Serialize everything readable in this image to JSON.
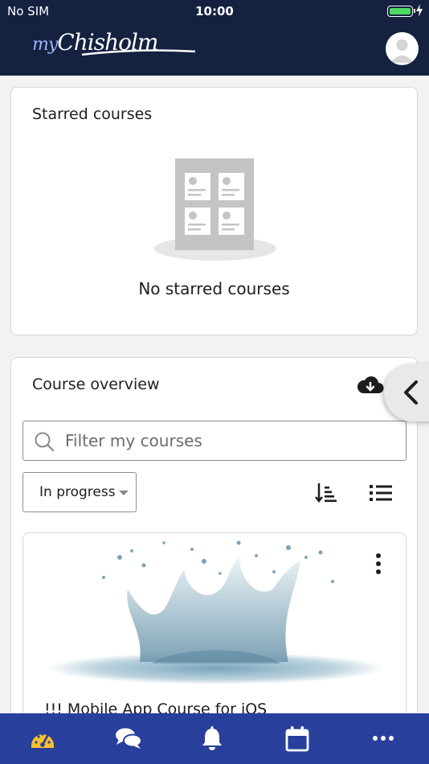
{
  "status_bar": {
    "carrier": "No SIM",
    "time": "10:00"
  },
  "header": {
    "logo_alt": "myChisholm",
    "logo_part1": "my",
    "logo_part2": "Chisholm",
    "avatar_icon": "user-avatar-icon"
  },
  "starred": {
    "title": "Starred courses",
    "empty_message": "No starred courses",
    "illustration_icon": "empty-courses-icon"
  },
  "overview": {
    "title": "Course overview",
    "download_icon": "cloud-download-icon",
    "filter_placeholder": "Filter my courses",
    "status_filter": "In progress",
    "sort_icon": "sort-icon",
    "view_icon": "list-view-icon",
    "course": {
      "name": "!!! Mobile App Course for iOS",
      "menu_icon": "more-vertical-icon"
    }
  },
  "tabbar": {
    "items": [
      {
        "icon": "dashboard-icon"
      },
      {
        "icon": "messages-icon"
      },
      {
        "icon": "notifications-icon"
      },
      {
        "icon": "calendar-icon"
      },
      {
        "icon": "more-icon"
      }
    ]
  },
  "colors": {
    "header_bg": "#14213f",
    "tabbar_bg": "#283f9c",
    "active_tab": "#f8c12c",
    "battery": "#4cd964"
  }
}
